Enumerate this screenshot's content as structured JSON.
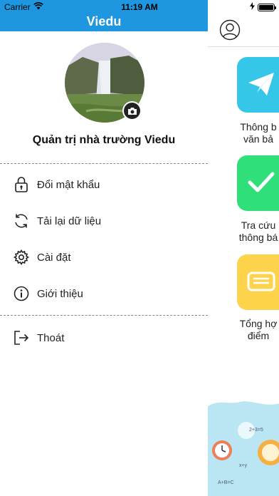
{
  "status_bar": {
    "carrier": "Carrier",
    "time": "11:19 AM"
  },
  "drawer": {
    "title": "Viedu",
    "school_name": "Quản trị nhà trường Viedu",
    "menu": [
      {
        "label": "Đổi mật khẩu",
        "icon": "lock-icon"
      },
      {
        "label": "Tải lại dữ liệu",
        "icon": "refresh-icon"
      },
      {
        "label": "Cài đặt",
        "icon": "gear-icon"
      },
      {
        "label": "Giới thiệu",
        "icon": "info-icon"
      }
    ],
    "logout": {
      "label": "Thoát",
      "icon": "logout-icon"
    }
  },
  "main": {
    "tiles": [
      {
        "line1": "Thông b",
        "line2": "văn bả",
        "color": "#35c6e8",
        "icon": "paper-plane-icon"
      },
      {
        "line1": "Tra cứu",
        "line2": "thông bá",
        "color": "#2fe07a",
        "icon": "checkmark-icon"
      },
      {
        "line1": "Tổng hợ",
        "line2": "điểm",
        "color": "#fcd34a",
        "icon": "message-icon"
      }
    ],
    "art_text": [
      "2+3=5",
      "x+y",
      "A+B=C"
    ]
  },
  "colors": {
    "header_blue": "#1e97e0"
  }
}
